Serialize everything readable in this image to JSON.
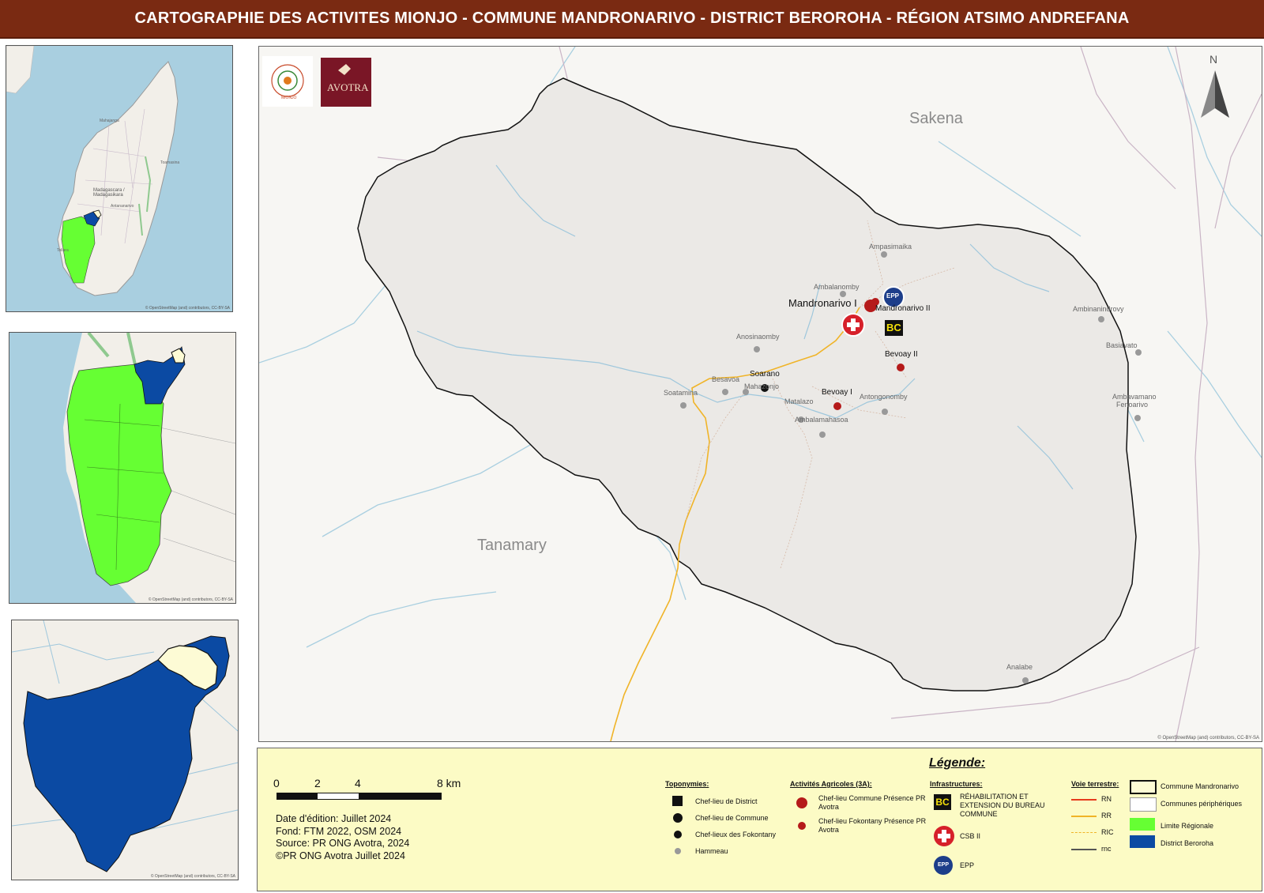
{
  "title": "CARTOGRAPHIE DES ACTIVITES MIONJO -  COMMUNE MANDRONARIVO - DISTRICT BEROROHA - RÉGION ATSIMO ANDREFANA",
  "insets": {
    "madagascar": {
      "country_label": "Madagascara / Madagasikara",
      "city_labels": [
        "Antananarivo",
        "Toamasina",
        "Mahajanga",
        "Toliara"
      ],
      "credit": "© OpenStreetMap (and) contributors, CC-BY-SA"
    },
    "region": {
      "credit": "© OpenStreetMap (and) contributors, CC-BY-SA"
    },
    "district": {
      "credit": "© OpenStreetMap (and) contributors, CC-BY-SA"
    }
  },
  "map": {
    "north_label": "N",
    "logos": {
      "mionjo_text": "MIONJO",
      "avotra_text": "AVOTRA"
    },
    "neighbor_labels": {
      "sakena": "Sakena",
      "tanamary": "Tanamary"
    },
    "commune_chief_town": "Mandronarivo I",
    "fokontany": {
      "mandronarivo2": "Mandronarivo II",
      "bevoay2": "Bevoay II",
      "bevoay1": "Bevoay I",
      "soarano": "Soarano"
    },
    "hamlets": {
      "ampasimaika": "Ampasimaika",
      "ambalanomby": "Ambalanomby",
      "anosinaomby": "Anosinaomby",
      "besavoa": "Besavoa",
      "mahazonjo": "Mahazonjo",
      "soatamina": "Soatamina",
      "matalazo": "Matalazo",
      "antongonomby": "Antongonomby",
      "ambalamahasoa": "Ambalamahasoa",
      "ambinanindrovy": "Ambinanindrovy",
      "basiavato": "Basiavato",
      "ambavamano": "Ambavamano",
      "fenoarivo": "Fenoarivo",
      "analabe": "Analabe"
    },
    "infra_icons": {
      "epp": "EPP",
      "bc": "BC"
    },
    "credit": "© OpenStreetMap (and) contributors, CC-BY-SA"
  },
  "legend": {
    "title": "Légende:",
    "scale_ticks": [
      "0",
      "2",
      "4",
      "8 km"
    ],
    "info_lines": [
      "Date d'édition: Juillet 2024",
      "Fond: FTM 2022, OSM 2024",
      "Source: PR ONG Avotra, 2024",
      "©PR ONG Avotra Juillet 2024"
    ],
    "toponymies": {
      "title": "Toponymies:",
      "items": [
        "Chef-lieu de District",
        "Chef-lieu de Commune",
        "Chef-lieux des Fokontany",
        "Hammeau"
      ]
    },
    "activites": {
      "title": "Activités Agricoles (3A):",
      "items": [
        "Chef-lieu Commune Présence PR Avotra",
        "Chef-lieu Fokontany Présence PR Avotra"
      ]
    },
    "infrastructures": {
      "title": "Infrastructures:",
      "items": [
        "RÉHABILITATION ET EXTENSION DU BUREAU COMMUNE",
        "CSB II",
        "EPP"
      ]
    },
    "voie": {
      "title": "Voie terrestre:",
      "items": [
        "RN",
        "RR",
        "RIC",
        "rnc"
      ]
    },
    "areas": {
      "items": [
        "Commune Mandronarivo",
        "Communes périphériques",
        "Limite Régionale",
        "District Beroroha"
      ]
    }
  },
  "colors": {
    "title_bg": "#7a2a12",
    "legend_bg": "#fcfbc5",
    "region_green": "#66ff33",
    "district_blue": "#0b4aa3",
    "commune_fill": "#fdfbd5",
    "activity_red": "#b51a1a",
    "road_rn": "#e63c1e",
    "road_rr": "#f0b428",
    "sea": "#a9cfe0"
  }
}
